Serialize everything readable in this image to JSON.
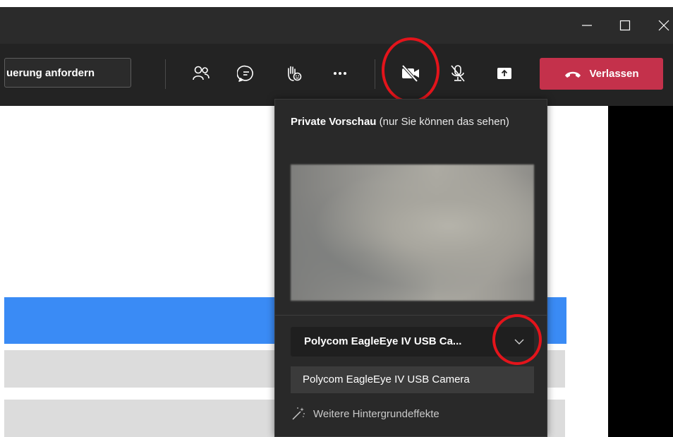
{
  "toolbar": {
    "control_button_label": "uerung anfordern",
    "icons": [
      "participants-icon",
      "chat-icon",
      "raise-hand-icon",
      "more-icon",
      "camera-off-icon",
      "mic-off-icon",
      "share-icon"
    ],
    "leave_label": "Verlassen"
  },
  "preview_popup": {
    "title_bold": "Private Vorschau",
    "title_rest": " (nur Sie können das sehen)",
    "camera_selected": "Polycom EagleEye IV USB Ca...",
    "camera_option": "Polycom EagleEye IV USB Camera",
    "background_effects_label": "Weitere Hintergrundeffekte"
  },
  "colors": {
    "leave_button": "#c4314b",
    "highlight_circle": "#e3141b",
    "selected_row": "#3a8bf5"
  }
}
